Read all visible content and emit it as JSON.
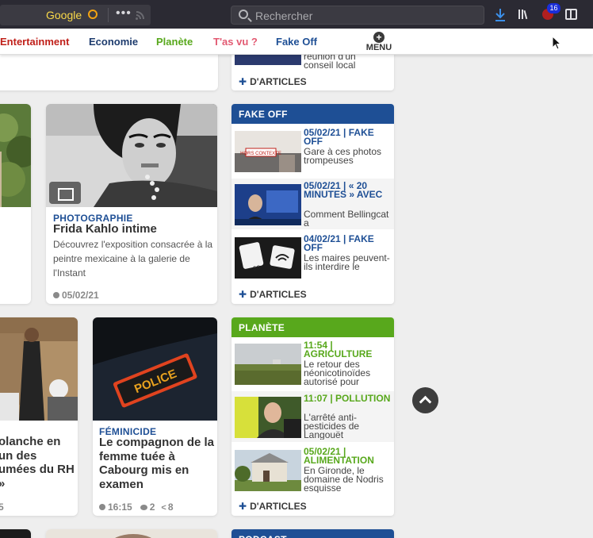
{
  "browser": {
    "google_label": "Google",
    "search_placeholder": "Rechercher",
    "extension_badge": "16"
  },
  "nav": {
    "items": [
      {
        "label": "Entertainment",
        "color": "#c0201a"
      },
      {
        "label": "Economie",
        "color": "#1e3c6e"
      },
      {
        "label": "Planète",
        "color": "#58a81c"
      },
      {
        "label": "T'as vu ?",
        "color": "#e25a72"
      },
      {
        "label": "Fake Off",
        "color": "#1e4f95"
      }
    ],
    "menu_label": "MENU"
  },
  "top_box": {
    "snippet_line1": "réunion d'un",
    "snippet_line2": "conseil local",
    "more_label": "D'ARTICLES"
  },
  "cards": {
    "frida": {
      "kicker": "PHOTOGRAPHIE",
      "title": "Frida Kahlo intime",
      "desc": "Découvrez l'exposition consacrée à la peintre mexicaine à la galerie de l'Instant",
      "date": "05/02/21"
    },
    "police": {
      "kicker": "FÉMINICIDE",
      "title": "Le compagnon de la femme tuée à Cabourg mis en examen",
      "time": "16:15",
      "comments": "2",
      "shares": "8"
    },
    "left_partial": {
      "title": "olanche en un des umées du RH »",
      "meta": "5"
    }
  },
  "fake_off": {
    "header": "FAKE OFF",
    "color": "#1e4f95",
    "items": [
      {
        "stamp": "05/02/21 | FAKE OFF",
        "text": "Gare à ces photos trompeuses",
        "thumb_label": "HORS CONTEXTE"
      },
      {
        "stamp": "05/02/21 | « 20 MINUTES » AVEC",
        "text": "Comment Bellingcat a"
      },
      {
        "stamp": "04/02/21 | FAKE OFF",
        "text": "Les maires peuvent-ils interdire le",
        "thumb_label": "5G"
      }
    ],
    "more_label": "D'ARTICLES"
  },
  "planete": {
    "header": "PLANÈTE",
    "color": "#58a81c",
    "items": [
      {
        "stamp": "11:54 | AGRICULTURE",
        "text": "Le retour des néonicotinoïdes autorisé pour"
      },
      {
        "stamp": "11:07 | POLLUTION",
        "text": "L'arrêté anti-pesticides de Langouët"
      },
      {
        "stamp": "05/02/21 | ALIMENTATION",
        "text": "En Gironde, le domaine de Nodris esquisse"
      }
    ],
    "more_label": "D'ARTICLES"
  },
  "podcast": {
    "header": "PODCAST"
  }
}
